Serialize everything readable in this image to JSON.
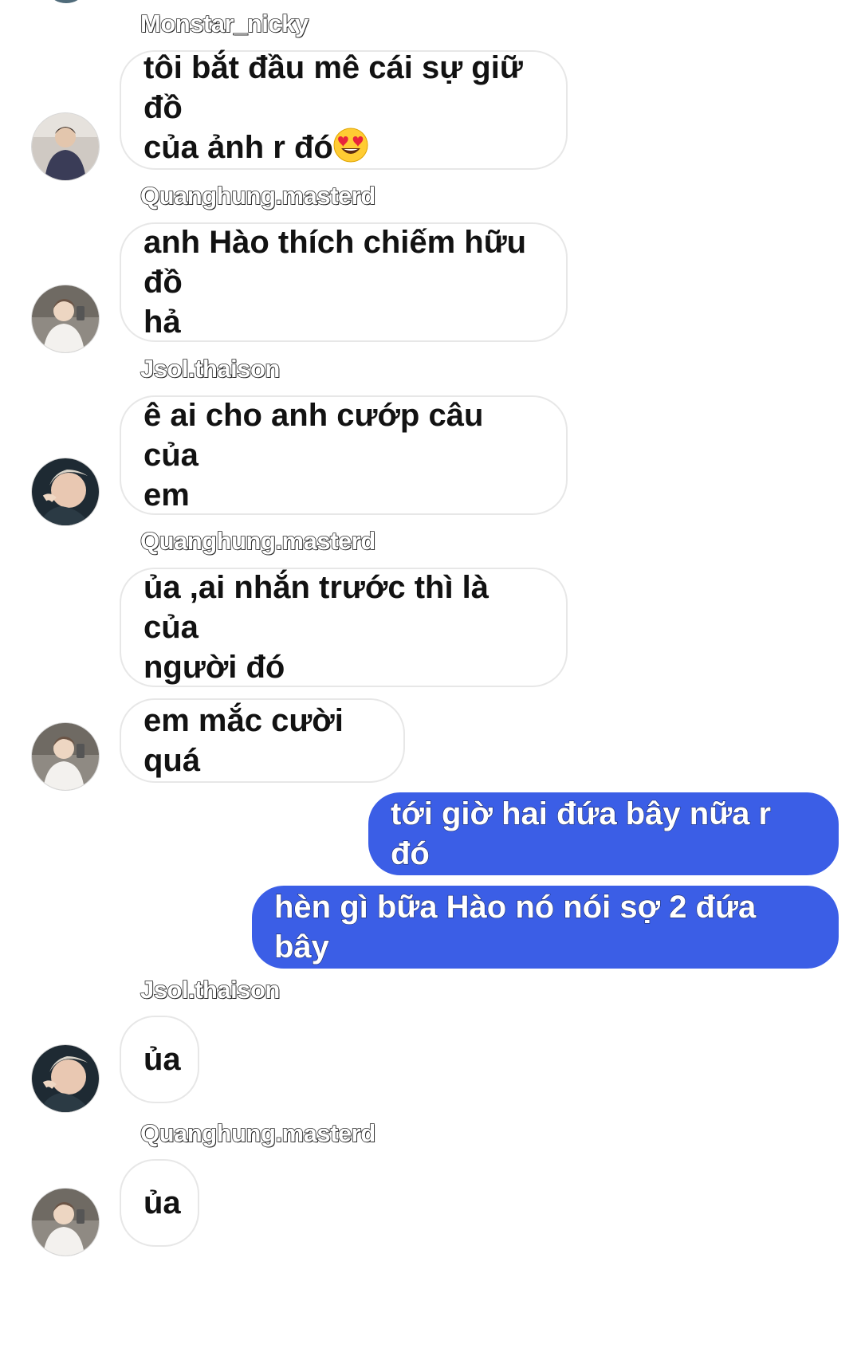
{
  "messages": [
    {
      "sender": "Monstar_nicky",
      "lines": [
        "tôi bắt đầu mê cái sự giữ đồ",
        "của ảnh r đó"
      ],
      "emoji": "smiling-face-with-heart-eyes"
    },
    {
      "sender": "Quanghung.masterd",
      "lines": [
        "anh Hào thích chiếm hữu đồ",
        "hả"
      ]
    },
    {
      "sender": "Jsol.thaison",
      "lines": [
        "ê ai cho anh cướp câu của",
        "em"
      ]
    },
    {
      "sender": "Quanghung.masterd",
      "lines": [
        "ủa ,ai nhắn trước thì là của",
        "người đó"
      ]
    },
    {
      "lines": [
        "em mắc cười quá"
      ]
    },
    {
      "outgoing": true,
      "text": "tới giờ hai đứa bây nữa r đó"
    },
    {
      "outgoing": true,
      "text": "hèn gì bữa Hào nó nói sợ 2 đứa bây"
    },
    {
      "sender": "Jsol.thaison",
      "lines": [
        "ủa"
      ]
    },
    {
      "sender": "Quanghung.masterd",
      "lines": [
        "ủa"
      ]
    }
  ],
  "colors": {
    "outgoing_bubble": "#3b5ee6",
    "incoming_bubble": "#ffffff",
    "incoming_border": "#e7e7e7"
  }
}
